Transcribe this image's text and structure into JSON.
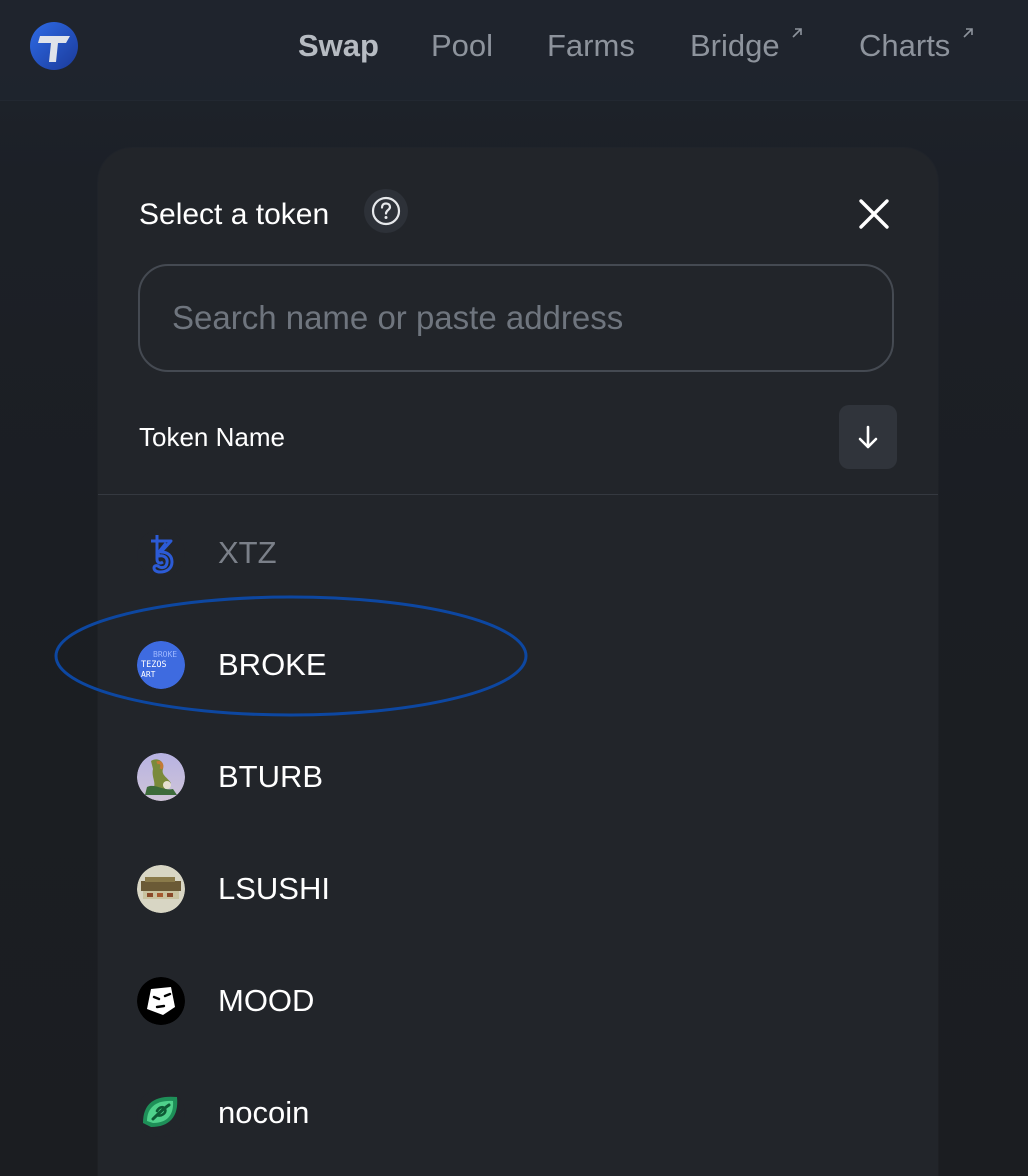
{
  "nav": {
    "items": [
      {
        "label": "Swap",
        "active": true,
        "external": false
      },
      {
        "label": "Pool",
        "active": false,
        "external": false
      },
      {
        "label": "Farms",
        "active": false,
        "external": false
      },
      {
        "label": "Bridge",
        "active": false,
        "external": true
      },
      {
        "label": "Charts",
        "active": false,
        "external": true
      }
    ]
  },
  "modal": {
    "title": "Select a token",
    "search_placeholder": "Search name or paste address",
    "search_value": "",
    "column_header": "Token Name",
    "sort_direction": "descending"
  },
  "tokens": [
    {
      "symbol": "XTZ",
      "icon": "tezos-icon",
      "dimmed": true,
      "highlighted": false
    },
    {
      "symbol": "BROKE",
      "icon": "broke-token-icon",
      "dimmed": false,
      "highlighted": true
    },
    {
      "symbol": "BTURB",
      "icon": "bturb-token-icon",
      "dimmed": false,
      "highlighted": false
    },
    {
      "symbol": "LSUSHI",
      "icon": "lsushi-token-icon",
      "dimmed": false,
      "highlighted": false
    },
    {
      "symbol": "MOOD",
      "icon": "mood-token-icon",
      "dimmed": false,
      "highlighted": false
    },
    {
      "symbol": "nocoin",
      "icon": "nocoin-token-icon",
      "dimmed": false,
      "highlighted": false
    }
  ],
  "icon_text": {
    "broke": [
      "BROKE",
      "TEZOS",
      "ART"
    ]
  },
  "colors": {
    "accent": "#2c5bd6",
    "highlight_ring": "#0d47a1"
  }
}
